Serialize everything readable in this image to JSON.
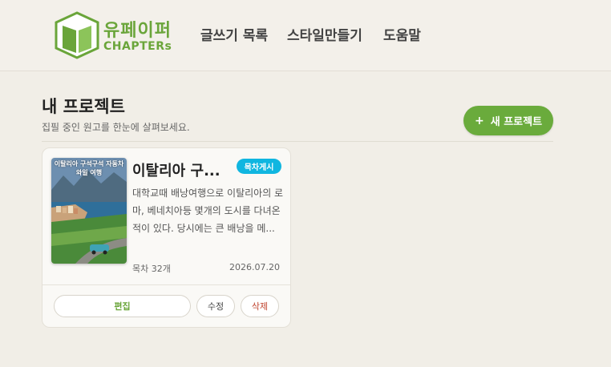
{
  "brand": {
    "name_ko": "유페이퍼",
    "name_en": "CHAPTERs"
  },
  "nav": [
    "글쓰기 목록",
    "스타일만들기",
    "도움말"
  ],
  "page": {
    "title": "내 프로젝트",
    "subtitle": "집필 중인 원고를 한눈에 살펴보세요.",
    "new_button": "새 프로젝트"
  },
  "projects": [
    {
      "cover_title": "이탈리아 구석구석 자동차 와일 여행",
      "title": "이탈리아 구...",
      "badge": "목차게시",
      "description": "대학교때 배낭여행으로 이탈리아의 로마, 베네치아등 몇개의 도시를 다녀온 적이 있다. 당시에는 큰 배낭을 메...",
      "count": "목차 32개",
      "date": "2026.07.20",
      "buttons": {
        "edit": "편집",
        "modify": "수정",
        "delete": "삭제"
      }
    }
  ],
  "colors": {
    "brand_green": "#6aa53a",
    "badge_blue": "#10b6e0",
    "delete_red": "#c0452f"
  }
}
